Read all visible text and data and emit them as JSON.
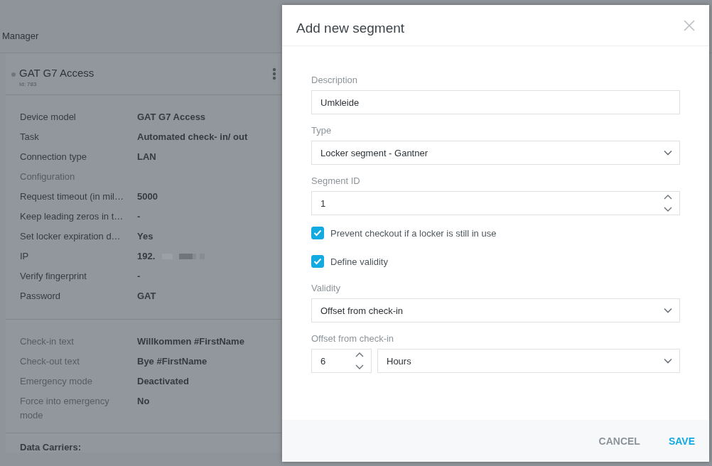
{
  "page": {
    "title": "Manager"
  },
  "device": {
    "name": "GAT G7 Access",
    "id": "Id: 783",
    "sections": [
      {
        "rows": [
          {
            "kind": "field",
            "label": "Device model",
            "value": "GAT G7 Access"
          },
          {
            "kind": "field",
            "label": "Task",
            "value": "Automated check- in/ out"
          },
          {
            "kind": "field",
            "label": "Connection type",
            "value": "LAN"
          },
          {
            "kind": "heading",
            "label": "Configuration"
          },
          {
            "kind": "field",
            "label": "Request timeout (in mil…",
            "value": "5000"
          },
          {
            "kind": "field",
            "label": "Keep leading zeros in t…",
            "value": "-"
          },
          {
            "kind": "field",
            "label": "Set locker expiration d…",
            "value": "Yes"
          },
          {
            "kind": "field",
            "label": "IP",
            "value": "192."
          },
          {
            "kind": "field",
            "label": "Verify fingerprint",
            "value": "-"
          },
          {
            "kind": "field",
            "label": "Password",
            "value": "GAT"
          }
        ]
      },
      {
        "rows": [
          {
            "kind": "option",
            "label": "Check-in text",
            "value": "Willkommen #FirstName"
          },
          {
            "kind": "option",
            "label": "Check-out text",
            "value": "Bye #FirstName"
          },
          {
            "kind": "option",
            "label": "Emergency mode",
            "value": "Deactivated"
          },
          {
            "kind": "option",
            "label": "Force into emergency mode",
            "value": "No"
          }
        ]
      }
    ],
    "footer": "Data Carriers:"
  },
  "dialog": {
    "title": "Add new segment",
    "fields": [
      {
        "kind": "text",
        "label": "Description",
        "value": "Umkleide"
      },
      {
        "kind": "select",
        "label": "Type",
        "value": "Locker segment - Gantner"
      },
      {
        "kind": "number",
        "label": "Segment ID",
        "value": "1"
      },
      {
        "kind": "checkbox",
        "label": "Prevent checkout if a locker is still in use",
        "checked": true
      },
      {
        "kind": "checkbox",
        "label": "Define validity",
        "checked": true
      },
      {
        "kind": "select",
        "label": "Validity",
        "value": "Offset from check-in"
      },
      {
        "kind": "offset",
        "label": "Offset from check-in",
        "value": "6",
        "unit": "Hours"
      }
    ],
    "buttons": [
      {
        "label": "CANCEL",
        "primary": false
      },
      {
        "label": "SAVE",
        "primary": true
      }
    ]
  }
}
